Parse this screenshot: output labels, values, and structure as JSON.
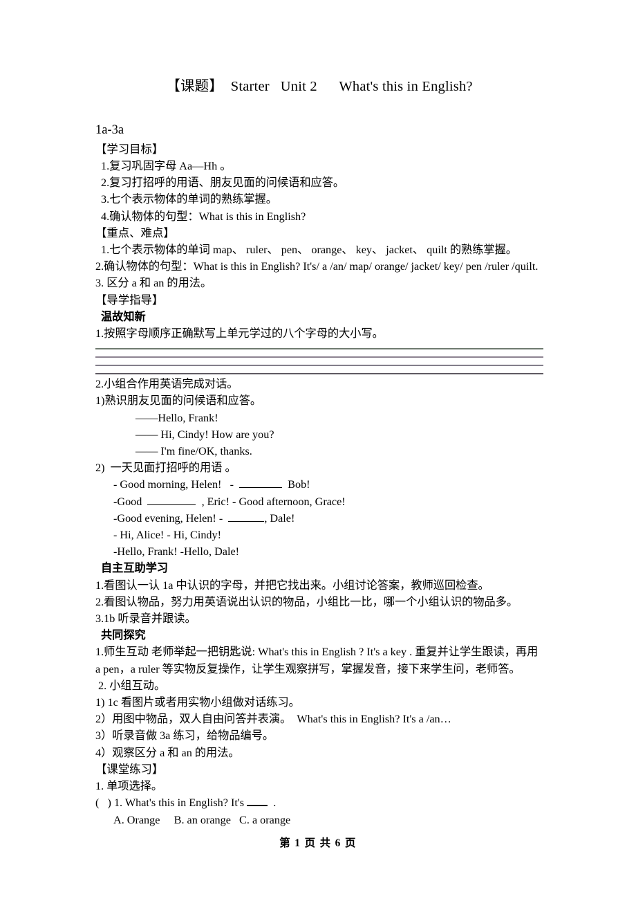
{
  "document": {
    "title": "【课题】  Starter   Unit 2      What's this in English?",
    "subtitle": "1a-3a",
    "footer": "第 1 页 共 6 页"
  },
  "objectives": {
    "heading": "【学习目标】",
    "items": [
      "1.复习巩固字母 Aa—Hh 。",
      "2.复习打招呼的用语、朋友见面的问候语和应答。",
      "3.七个表示物体的单词的熟练掌握。",
      "4.确认物体的句型：What is this in English?"
    ]
  },
  "key_points": {
    "heading": "【重点、难点】",
    "items": [
      "1.七个表示物体的单词 map、 ruler、 pen、 orange、 key、 jacket、 quilt 的熟练掌握。",
      "2.确认物体的句型：What is this in English? It's/ a /an/ map/ orange/ jacket/ key/ pen /ruler /quilt.",
      "3. 区分 a 和 an 的用法。"
    ]
  },
  "guidance": {
    "heading": "【导学指导】",
    "review": {
      "heading": "温故知新",
      "task1": "1.按照字母顺序正确默写上单元学过的八个字母的大小写。",
      "blank_line_count": 4,
      "task2": "2.小组合作用英语完成对话。",
      "sub1": "1)熟识朋友见面的问候语和应答。",
      "dialogue1": [
        "——Hello, Frank!",
        "—— Hi, Cindy! How are you?",
        "—— I'm fine/OK, thanks."
      ],
      "sub2": "2)  一天见面打招呼的用语 。",
      "dialogue2": {
        "line1_a": "- Good morning, Helen!   -  ",
        "line1_b": "  Bob!",
        "line2_a": "-Good  ",
        "line2_b": "  , Eric! - Good afternoon, Grace!",
        "line3_a": "-Good evening, Helen! -  ",
        "line3_b": ", Dale!",
        "line4": "- Hi, Alice! - Hi, Cindy!",
        "line5": "-Hello, Frank! -Hello, Dale!"
      }
    }
  },
  "self_study": {
    "heading": "自主互助学习",
    "items": [
      "1.看图认一认 1a 中认识的字母，并把它找出来。小组讨论答案，教师巡回检查。",
      "2.看图认物品，努力用英语说出认识的物品，小组比一比，哪一个小组认识的物品多。",
      "3.1b 听录音并跟读。"
    ]
  },
  "inquiry": {
    "heading": "共同探究",
    "item1": "1.师生互动 老师举起一把钥匙说: What's this in English ? It's a key . 重复并让学生跟读，再用 a pen，a ruler 等实物反复操作，让学生观察拼写，掌握发音，接下来学生问，老师答。",
    "item2": " 2. 小组互动。",
    "sub_items": [
      "1) 1c 看图片或者用实物小组做对话练习。",
      "2）用图中物品，双人自由问答并表演。  What's this in English? It's a /an…",
      "3）听录音做 3a 练习，给物品编号。",
      "4）观察区分 a 和 an 的用法。"
    ]
  },
  "exercises": {
    "heading": "【课堂练习】",
    "section1": "1. 单项选择。",
    "question1_a": "(   ) 1. What's this in English? It's ",
    "question1_b": "  .",
    "question1_options": "A. Orange     B. an orange   C. a orange"
  }
}
